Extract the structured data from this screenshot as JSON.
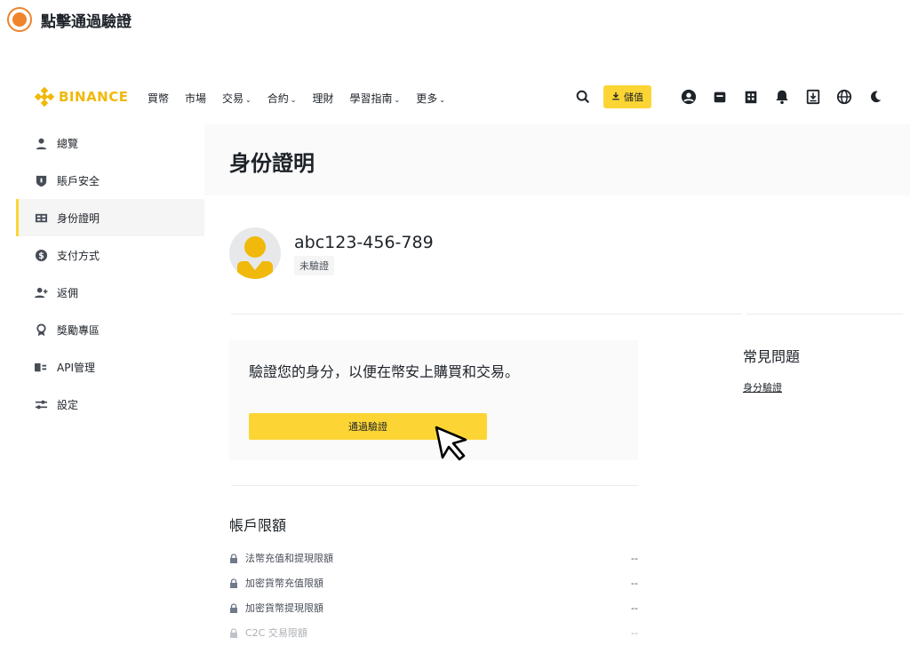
{
  "step": {
    "title": "點擊通過驗證"
  },
  "brand": {
    "name": "BINANCE",
    "color": "#f0b90b"
  },
  "nav": {
    "items": [
      {
        "label": "買幣",
        "caret": ""
      },
      {
        "label": "市場",
        "caret": ""
      },
      {
        "label": "交易",
        "caret": "⌄"
      },
      {
        "label": "合約",
        "caret": "⌄"
      },
      {
        "label": "理財",
        "caret": ""
      },
      {
        "label": "學習指南",
        "caret": "⌄"
      },
      {
        "label": "更多",
        "caret": "⌄"
      }
    ],
    "deposit_label": "儲值",
    "icons": [
      "search-icon",
      "download-icon",
      "user-icon",
      "wallet-icon",
      "orders-icon",
      "bell-icon",
      "app-download-icon",
      "globe-icon",
      "moon-icon"
    ]
  },
  "sidebar": {
    "items": [
      {
        "label": "總覽",
        "icon": "user-icon",
        "active": false
      },
      {
        "label": "賬戶安全",
        "icon": "shield-icon",
        "active": false
      },
      {
        "label": "身份證明",
        "icon": "id-card-icon",
        "active": true
      },
      {
        "label": "支付方式",
        "icon": "dollar-icon",
        "active": false
      },
      {
        "label": "返佣",
        "icon": "user-plus-icon",
        "active": false
      },
      {
        "label": "獎勵專區",
        "icon": "award-icon",
        "active": false
      },
      {
        "label": "API管理",
        "icon": "api-icon",
        "active": false
      },
      {
        "label": "設定",
        "icon": "sliders-icon",
        "active": false
      }
    ]
  },
  "page": {
    "title": "身份證明"
  },
  "profile": {
    "uid": "abc123-456-789",
    "status": "未驗證"
  },
  "verify": {
    "message": "驗證您的身分，以便在幣安上購買和交易。",
    "button_label": "通過驗證"
  },
  "faq": {
    "title": "常見問題",
    "link": "身分驗證"
  },
  "limits": {
    "title": "帳戶限額",
    "rows": [
      {
        "label": "法幣充值和提現限額",
        "value": "--"
      },
      {
        "label": "加密貨幣充值限額",
        "value": "--"
      },
      {
        "label": "加密貨幣提現限額",
        "value": "--"
      },
      {
        "label": "C2C 交易限額",
        "value": "--"
      }
    ]
  },
  "colors": {
    "accent": "#fcd535",
    "step": "#f0842c"
  }
}
